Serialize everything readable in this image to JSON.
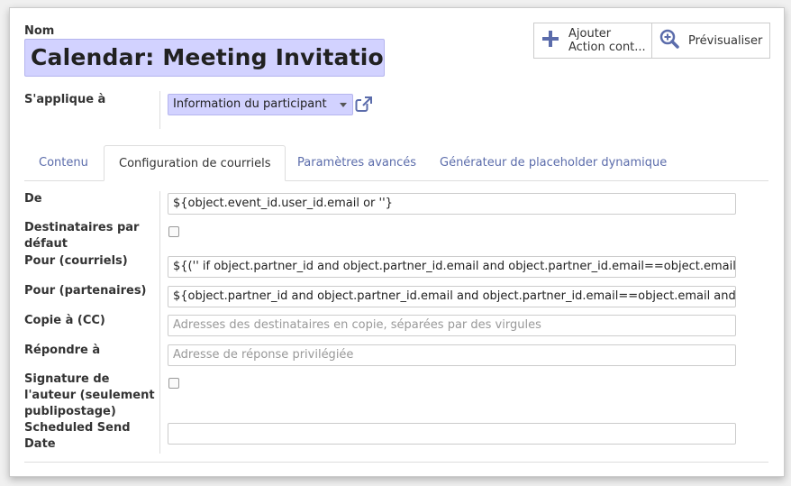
{
  "form": {
    "name_label": "Nom",
    "name_value": "Calendar: Meeting Invitation",
    "applies_label": "S'applique à",
    "applies_value": "Information du participant"
  },
  "buttons": {
    "add_line1": "Ajouter",
    "add_line2": "Action cont...",
    "preview": "Prévisualiser"
  },
  "tabs": [
    {
      "label": "Contenu",
      "active": false
    },
    {
      "label": "Configuration de courriels",
      "active": true
    },
    {
      "label": "Paramètres avancés",
      "active": false
    },
    {
      "label": "Générateur de placeholder dynamique",
      "active": false
    }
  ],
  "fields": {
    "from_label": "De",
    "from_value": "${object.event_id.user_id.email or ''}",
    "default_recipients_label_1": "Destinataires par",
    "default_recipients_label_2": "défaut",
    "to_emails_label": "Pour (courriels)",
    "to_emails_value": "${('' if object.partner_id and object.partner_id.email and object.partner_id.email==object.email else object.email)|safe}",
    "to_partners_label": "Pour (partenaires)",
    "to_partners_value": "${object.partner_id and object.partner_id.email and object.partner_id.email==object.email and object.partner_id.id or False}",
    "cc_label": "Copie à (CC)",
    "cc_placeholder": "Adresses des destinataires en copie, séparées par des virgules",
    "reply_to_label": "Répondre à",
    "reply_to_placeholder": "Adresse de réponse privilégiée",
    "signature_label_1": "Signature de",
    "signature_label_2": "l'auteur (seulement",
    "signature_label_3": "publipostage)",
    "scheduled_label_1": "Scheduled Send",
    "scheduled_label_2": "Date",
    "scheduled_value": ""
  },
  "colors": {
    "required_bg": "#d2d2ff",
    "tab_link": "#5b6cab",
    "icon": "#5b6cab"
  },
  "icons": {
    "add": "plus-icon",
    "preview": "zoom-in-icon",
    "external": "external-link-icon",
    "dropdown": "caret-down-icon"
  }
}
